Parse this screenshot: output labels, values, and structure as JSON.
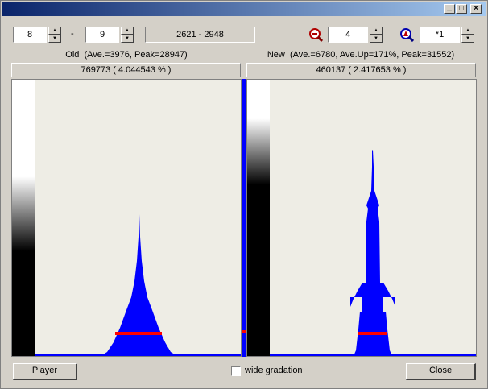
{
  "window": {
    "title": "",
    "minimize_glyph": "_",
    "maximize_glyph": "□",
    "close_glyph": "×"
  },
  "toolbar": {
    "range_start": "8",
    "range_separator": "-",
    "range_end": "9",
    "range_values": "2621 - 2948",
    "zoom_value": "4",
    "multiplier_value": "*1"
  },
  "old_panel": {
    "title": "Old  (Ave.=3976, Peak=28947)",
    "summary": "769773 ( 4.044543 % )"
  },
  "new_panel": {
    "title": "New  (Ave.=6780, Ave.Up=171%, Peak=31552)",
    "summary": "460137 ( 2.417653 % )"
  },
  "footer": {
    "player_label": "Player",
    "wide_gradation_label": "wide gradation",
    "wide_gradation_checked": false,
    "close_label": "Close"
  },
  "colors": {
    "histogram": "#0000ff",
    "average_line": "#ff0000",
    "panel_background": "#eeede5",
    "divider": "#0000ff"
  },
  "icons": {
    "zoom": "magnifier-minus-icon",
    "scale": "magnifier-target-icon"
  }
}
